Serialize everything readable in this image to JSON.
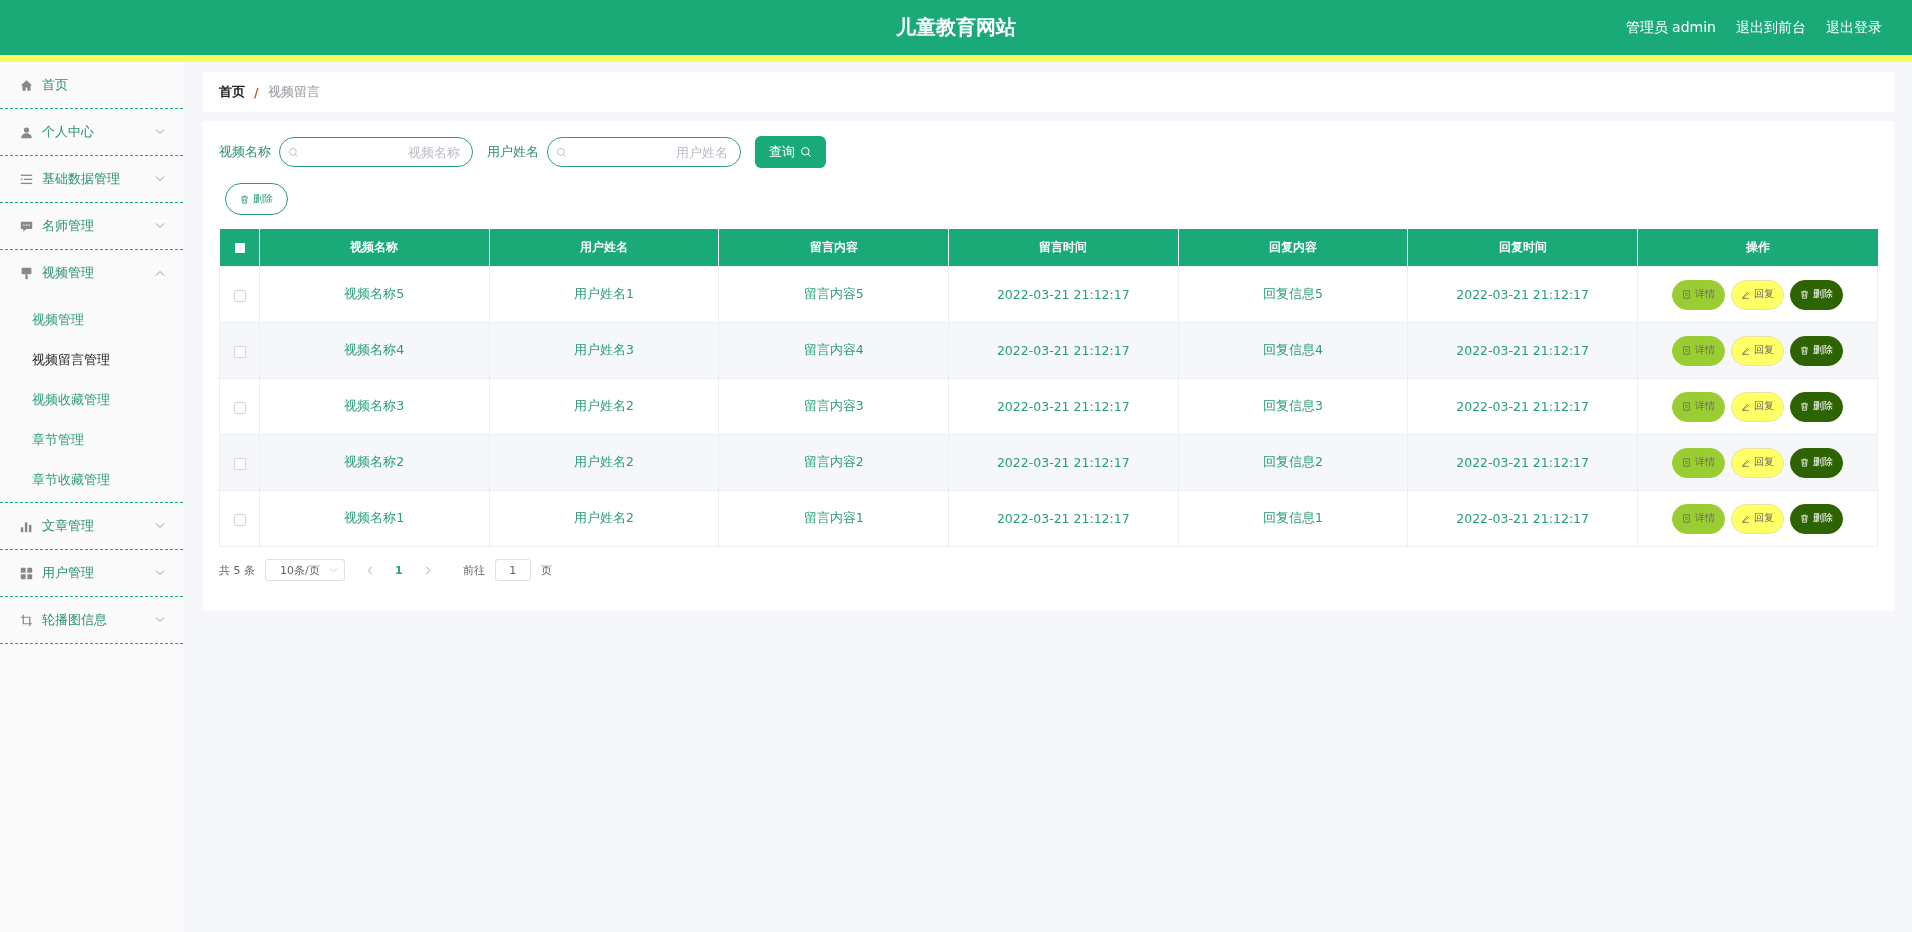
{
  "header": {
    "title": "儿童教育网站",
    "links": [
      "管理员 admin",
      "退出到前台",
      "退出登录"
    ]
  },
  "sidebar": {
    "items": [
      {
        "label": "首页",
        "kind": "link"
      },
      {
        "label": "个人中心",
        "kind": "menu",
        "expanded": false
      },
      {
        "label": "基础数据管理",
        "kind": "menu",
        "expanded": false
      },
      {
        "label": "名师管理",
        "kind": "menu",
        "expanded": false
      },
      {
        "label": "视频管理",
        "kind": "menu",
        "expanded": true,
        "children": [
          {
            "label": "视频管理",
            "selected": false
          },
          {
            "label": "视频留言管理",
            "selected": true
          },
          {
            "label": "视频收藏管理",
            "selected": false
          },
          {
            "label": "章节管理",
            "selected": false
          },
          {
            "label": "章节收藏管理",
            "selected": false
          }
        ]
      },
      {
        "label": "文章管理",
        "kind": "menu",
        "expanded": false
      },
      {
        "label": "用户管理",
        "kind": "menu",
        "expanded": false
      },
      {
        "label": "轮播图信息",
        "kind": "menu",
        "expanded": false
      }
    ]
  },
  "breadcrumb": {
    "separator": "/",
    "items": [
      "首页",
      "视频留言"
    ]
  },
  "search": {
    "fields": [
      {
        "label": "视频名称",
        "placeholder": "视频名称"
      },
      {
        "label": "用户姓名",
        "placeholder": "用户姓名"
      }
    ],
    "button": "查询",
    "delete_button": "删除"
  },
  "table": {
    "select_all_checked": false,
    "columns": [
      "视频名称",
      "用户姓名",
      "留言内容",
      "留言时间",
      "回复内容",
      "回复时间",
      "操作"
    ],
    "rows": [
      {
        "checked": false,
        "cells": [
          "视频名称5",
          "用户姓名1",
          "留言内容5",
          "2022-03-21 21:12:17",
          "回复信息5",
          "2022-03-21 21:12:17"
        ],
        "actions": [
          "详情",
          "回复",
          "删除"
        ]
      },
      {
        "checked": false,
        "cells": [
          "视频名称4",
          "用户姓名3",
          "留言内容4",
          "2022-03-21 21:12:17",
          "回复信息4",
          "2022-03-21 21:12:17"
        ],
        "actions": [
          "详情",
          "回复",
          "删除"
        ]
      },
      {
        "checked": false,
        "cells": [
          "视频名称3",
          "用户姓名2",
          "留言内容3",
          "2022-03-21 21:12:17",
          "回复信息3",
          "2022-03-21 21:12:17"
        ],
        "actions": [
          "详情",
          "回复",
          "删除"
        ]
      },
      {
        "checked": false,
        "cells": [
          "视频名称2",
          "用户姓名2",
          "留言内容2",
          "2022-03-21 21:12:17",
          "回复信息2",
          "2022-03-21 21:12:17"
        ],
        "actions": [
          "详情",
          "回复",
          "删除"
        ]
      },
      {
        "checked": false,
        "cells": [
          "视频名称1",
          "用户姓名2",
          "留言内容1",
          "2022-03-21 21:12:17",
          "回复信息1",
          "2022-03-21 21:12:17"
        ],
        "actions": [
          "详情",
          "回复",
          "删除"
        ]
      }
    ]
  },
  "pagination": {
    "total": "共 5 条",
    "page_size": "10条/页",
    "pages": [
      {
        "label": "1",
        "selected": true
      }
    ],
    "goto_label": "前往",
    "goto_value": "1",
    "goto_unit": "页"
  }
}
